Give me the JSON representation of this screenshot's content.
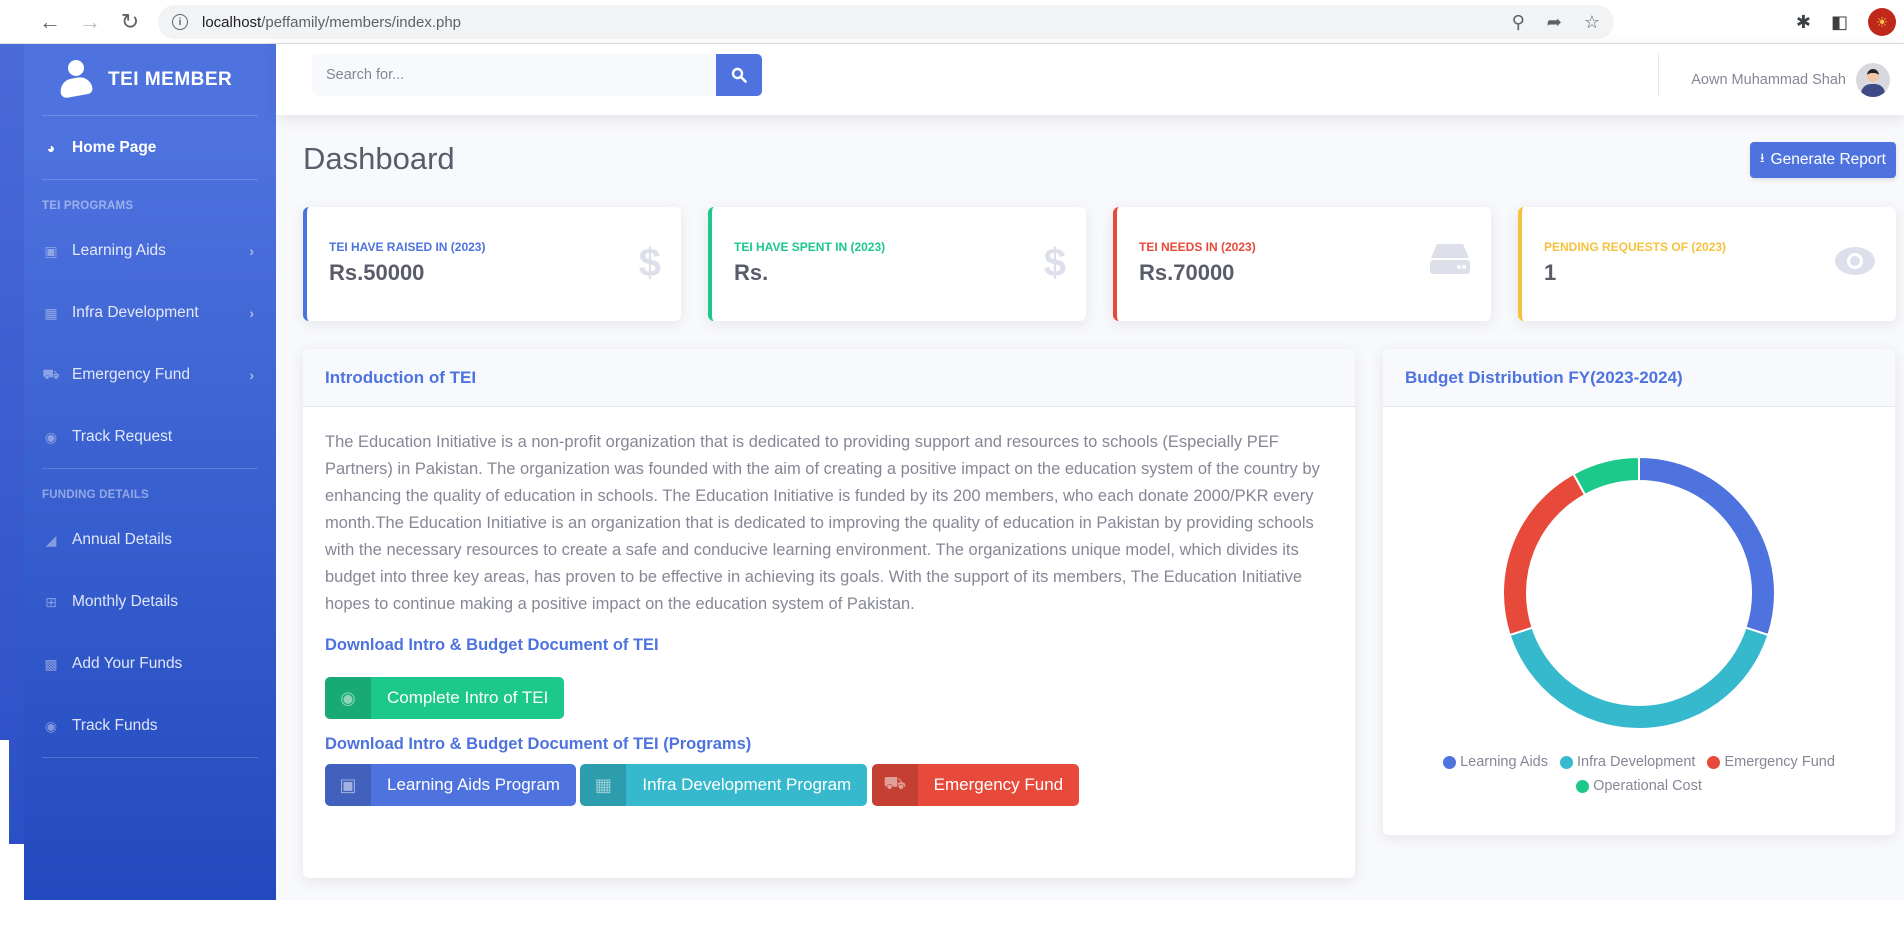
{
  "browser": {
    "url_host": "localhost",
    "url_path": "/peffamily/members/index.php"
  },
  "sidebar": {
    "brand": "TEI MEMBER",
    "home": "Home Page",
    "sections": [
      {
        "heading": "TEI PROGRAMS",
        "items": [
          {
            "label": "Learning Aids",
            "icon": "desktop-icon",
            "has_chevron": true
          },
          {
            "label": "Infra Development",
            "icon": "building-icon",
            "has_chevron": true
          },
          {
            "label": "Emergency Fund",
            "icon": "ambulance-icon",
            "has_chevron": true
          },
          {
            "label": "Track Request",
            "icon": "eye-icon",
            "has_chevron": false
          }
        ]
      },
      {
        "heading": "FUNDING DETAILS",
        "items": [
          {
            "label": "Annual Details",
            "icon": "area-chart-icon"
          },
          {
            "label": "Monthly Details",
            "icon": "table-icon"
          },
          {
            "label": "Add Your Funds",
            "icon": "money-bill-icon"
          },
          {
            "label": "Track Funds",
            "icon": "eye-icon"
          }
        ]
      }
    ]
  },
  "topbar": {
    "search_placeholder": "Search for...",
    "user_name": "Aown Muhammad Shah"
  },
  "page": {
    "title": "Dashboard",
    "generate_report": "Generate Report"
  },
  "stats": [
    {
      "label": "TEI HAVE RAISED IN (2023)",
      "value": "Rs.50000",
      "icon": "dollar-icon",
      "color": "#4e73df"
    },
    {
      "label": "TEI HAVE SPENT IN (2023)",
      "value": "Rs.",
      "icon": "dollar-icon",
      "color": "#1cc88a"
    },
    {
      "label": "TEI NEEDS IN (2023)",
      "value": "Rs.70000",
      "icon": "hdd-icon",
      "color": "#e74a3b"
    },
    {
      "label": "PENDING REQUESTS OF (2023)",
      "value": "1",
      "icon": "eye-icon",
      "color": "#f6c23e"
    }
  ],
  "intro": {
    "title": "Introduction of TEI",
    "text": "The Education Initiative is a non-profit organization that is dedicated to providing support and resources to schools (Especially PEF Partners) in Pakistan. The organization was founded with the aim of creating a positive impact on the education system of the country by enhancing the quality of education in schools. The Education Initiative is funded by its 200 members, who each donate 2000/PKR every month.The Education Initiative is an organization that is dedicated to improving the quality of education in Pakistan by providing schools with the necessary resources to create a safe and conducive learning environment. The organizations unique model, which divides its budget into three key areas, has proven to be effective in achieving its goals. With the support of its members, The Education Initiative hopes to continue making a positive impact on the education system of Pakistan.",
    "download_heading": "Download Intro & Budget Document of TEI",
    "complete_intro_btn": "Complete Intro of TEI",
    "programs_heading": "Download Intro & Budget Document of TEI (Programs)",
    "program_buttons": [
      {
        "label": "Learning Aids Program",
        "color": "#4e73df"
      },
      {
        "label": "Infra Development Program",
        "color": "#36b9cc"
      },
      {
        "label": "Emergency Fund",
        "color": "#e74a3b"
      }
    ]
  },
  "chart_data": {
    "type": "pie",
    "variant": "doughnut",
    "title": "Budget Distribution FY(2023-2024)",
    "categories": [
      "Learning Aids",
      "Infra Development",
      "Emergency Fund",
      "Operational Cost"
    ],
    "values": [
      30,
      40,
      22,
      8
    ],
    "colors": [
      "#4e73df",
      "#36b9cc",
      "#e74a3b",
      "#1cc88a"
    ],
    "legend": "bottom"
  }
}
